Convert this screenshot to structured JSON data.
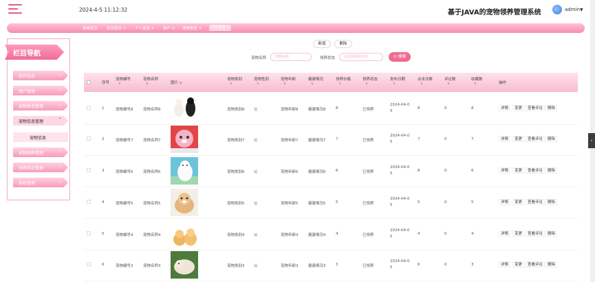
{
  "header": {
    "datetime": "2024-4-5 11:12:32",
    "title": "基于JAVA的宠物领养管理系统",
    "user": "admin"
  },
  "tabs": [
    {
      "label": "系统首页"
    },
    {
      "label": "修改密码 ✕"
    },
    {
      "label": "个人信息 ✕"
    },
    {
      "label": "用户 ✕"
    },
    {
      "label": "宠物类型 ✕"
    },
    {
      "label": "宠物信息 ✕"
    }
  ],
  "sidebar": {
    "title": "栏目导航",
    "items": [
      {
        "label": "我的信息",
        "caret": "⌄"
      },
      {
        "label": "用户管理",
        "caret": "⌄"
      },
      {
        "label": "宠物类型管理",
        "caret": "⌄"
      },
      {
        "label": "宠物信息管理",
        "caret": "⌃"
      },
      {
        "label": "宠物信息",
        "caret": ""
      },
      {
        "label": "宠物领养管理",
        "caret": "⌄"
      },
      {
        "label": "领养回访管理",
        "caret": "⌄"
      },
      {
        "label": "系统管理",
        "caret": "⌄"
      }
    ]
  },
  "toolbar": {
    "add": "新增",
    "delete": "删除"
  },
  "search": {
    "name_label": "宠物名称",
    "name_placeholder": "宠物名称",
    "status_label": "领养状态",
    "status_placeholder": "请选择领养状态",
    "button": "搜索"
  },
  "table": {
    "headers": [
      "序号",
      "宠物编号",
      "宠物名称",
      "图片",
      "宠物类别",
      "宠物性别",
      "宠物年龄",
      "健康情况",
      "领养价格",
      "领养状态",
      "发布日期",
      "点击次数",
      "评论数",
      "收藏数",
      "操作"
    ],
    "sort_glyph": "⇅",
    "actions": [
      "详情",
      "变更",
      "查看评论",
      "删除"
    ],
    "rows": [
      {
        "index": "1",
        "code": "宠物编号8",
        "name": "宠物名称8",
        "type": "宠物类别8",
        "sex": "公",
        "age": "宠物年龄8",
        "health": "健康情况8",
        "price": "8",
        "status": "已领养",
        "date1": "2024-04-0",
        "date2": "5",
        "clicks": "8",
        "comments": "0",
        "favs": "8"
      },
      {
        "index": "2",
        "code": "宠物编号7",
        "name": "宠物名称7",
        "type": "宠物类别7",
        "sex": "公",
        "age": "宠物年龄7",
        "health": "健康情况7",
        "price": "7",
        "status": "已领养",
        "date1": "2024-04-0",
        "date2": "5",
        "clicks": "7",
        "comments": "0",
        "favs": "7"
      },
      {
        "index": "3",
        "code": "宠物编号6",
        "name": "宠物名称6",
        "type": "宠物类别6",
        "sex": "公",
        "age": "宠物年龄6",
        "health": "健康情况6",
        "price": "6",
        "status": "已领养",
        "date1": "2024-04-0",
        "date2": "5",
        "clicks": "8",
        "comments": "0",
        "favs": "6"
      },
      {
        "index": "4",
        "code": "宠物编号5",
        "name": "宠物名称5",
        "type": "宠物类别5",
        "sex": "公",
        "age": "宠物年龄5",
        "health": "健康情况5",
        "price": "5",
        "status": "已领养",
        "date1": "2024-04-0",
        "date2": "5",
        "clicks": "5",
        "comments": "0",
        "favs": "5"
      },
      {
        "index": "5",
        "code": "宠物编号4",
        "name": "宠物名称4",
        "type": "宠物类别4",
        "sex": "公",
        "age": "宠物年龄4",
        "health": "健康情况4",
        "price": "4",
        "status": "已领养",
        "date1": "2024-04-0",
        "date2": "5",
        "clicks": "4",
        "comments": "0",
        "favs": "4"
      },
      {
        "index": "6",
        "code": "宠物编号3",
        "name": "宠物名称3",
        "type": "宠物类别3",
        "sex": "公",
        "age": "宠物年龄3",
        "health": "健康情况3",
        "price": "3",
        "status": "已领养",
        "date1": "2024-04-0",
        "date2": "5",
        "clicks": "6",
        "comments": "0",
        "favs": "3"
      }
    ]
  },
  "colors": {
    "accent": "#f06a92",
    "header_pink": "#f7bdd0"
  }
}
